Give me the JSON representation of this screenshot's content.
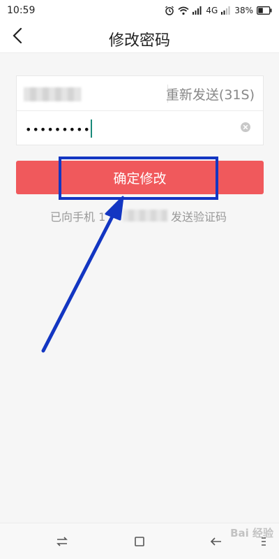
{
  "status_bar": {
    "time": "10:59",
    "network": "4G",
    "battery": "38%",
    "icons": [
      "alarm-icon",
      "wifi-icon",
      "signal-icon",
      "battery-icon"
    ]
  },
  "header": {
    "title": "修改密码",
    "back_icon": "chevron-left-icon"
  },
  "form": {
    "phone_row": {
      "resend_label": "重新发送(31S)"
    },
    "password_field": {
      "value": "•••••••••",
      "clear_icon": "clear-icon"
    }
  },
  "confirm_button": {
    "label": "确定修改",
    "color": "#f0595c"
  },
  "hint": {
    "prefix": "已向手机 1",
    "suffix": "发送验证码"
  },
  "annotation": {
    "highlight_color": "#1336c2"
  },
  "bottom_nav": {
    "icons": [
      "swap-icon",
      "home-square-icon",
      "back-arrow-icon",
      "menu-icon"
    ]
  },
  "watermark": {
    "text": "Bai 经验"
  }
}
